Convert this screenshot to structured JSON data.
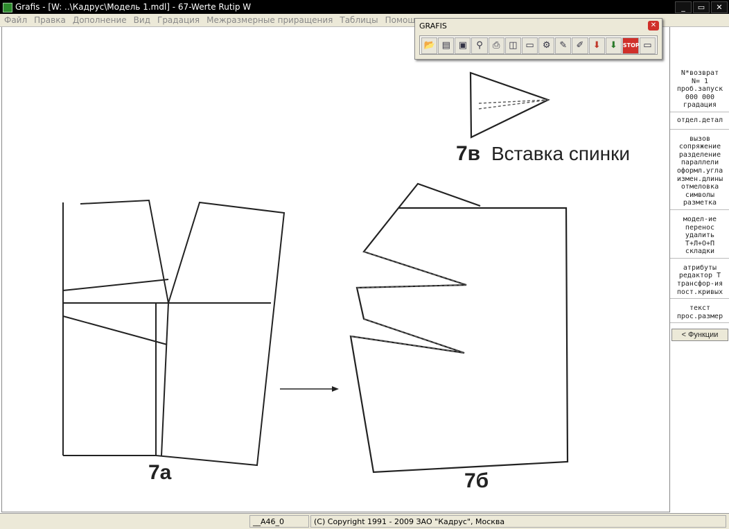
{
  "window": {
    "title": "Grafis - [W: ..\\Кадрус\\Модель 1.mdl] - 67-Werte Rutip W",
    "buttons": [
      "_",
      "▭",
      "✕"
    ]
  },
  "menu": [
    "Файл",
    "Правка",
    "Дополнение",
    "Вид",
    "Градация",
    "Межразмерные приращения",
    "Таблицы",
    "Помощь"
  ],
  "toolbar": {
    "title": "GRAFIS",
    "icons": [
      "open-folder-icon",
      "open-file-icon",
      "save-icon",
      "magnifier-icon",
      "printer-icon",
      "layers-icon",
      "ruler-icon",
      "tools-icon",
      "shape-edit-icon",
      "shape-edit-2-icon",
      "download-red-icon",
      "download-green-icon",
      "stop-icon",
      "monitor-icon"
    ]
  },
  "drawing": {
    "label_a": "7а",
    "label_b": "7б",
    "label_v_num": "7в",
    "label_v_text": "Вставка спинки"
  },
  "right_panel": {
    "group1": [
      "N*возврат",
      "N=  1",
      "проб.запуск",
      "000 000",
      "градация"
    ],
    "group2": [
      "отдел.детал"
    ],
    "group3": [
      "вызов",
      "сопряжение",
      "разделение",
      "параллели",
      "оформл.угла",
      "измен.длины",
      "отмеловка",
      "символы",
      "разметка"
    ],
    "group4": [
      "модел-ие",
      "перенос",
      "удалить",
      "Т+Л+О+П",
      "складки"
    ],
    "group5": [
      "атрибуты",
      "редактор Т",
      "трансфор-ия",
      "пост.кривых"
    ],
    "group6": [
      "текст",
      "прос.размер"
    ],
    "functions_button": "< Функции"
  },
  "status": {
    "cell1": "__A46_0",
    "cell2": "(C) Copyright 1991 - 2009 ЗАО \"Кадрус\", Москва"
  }
}
